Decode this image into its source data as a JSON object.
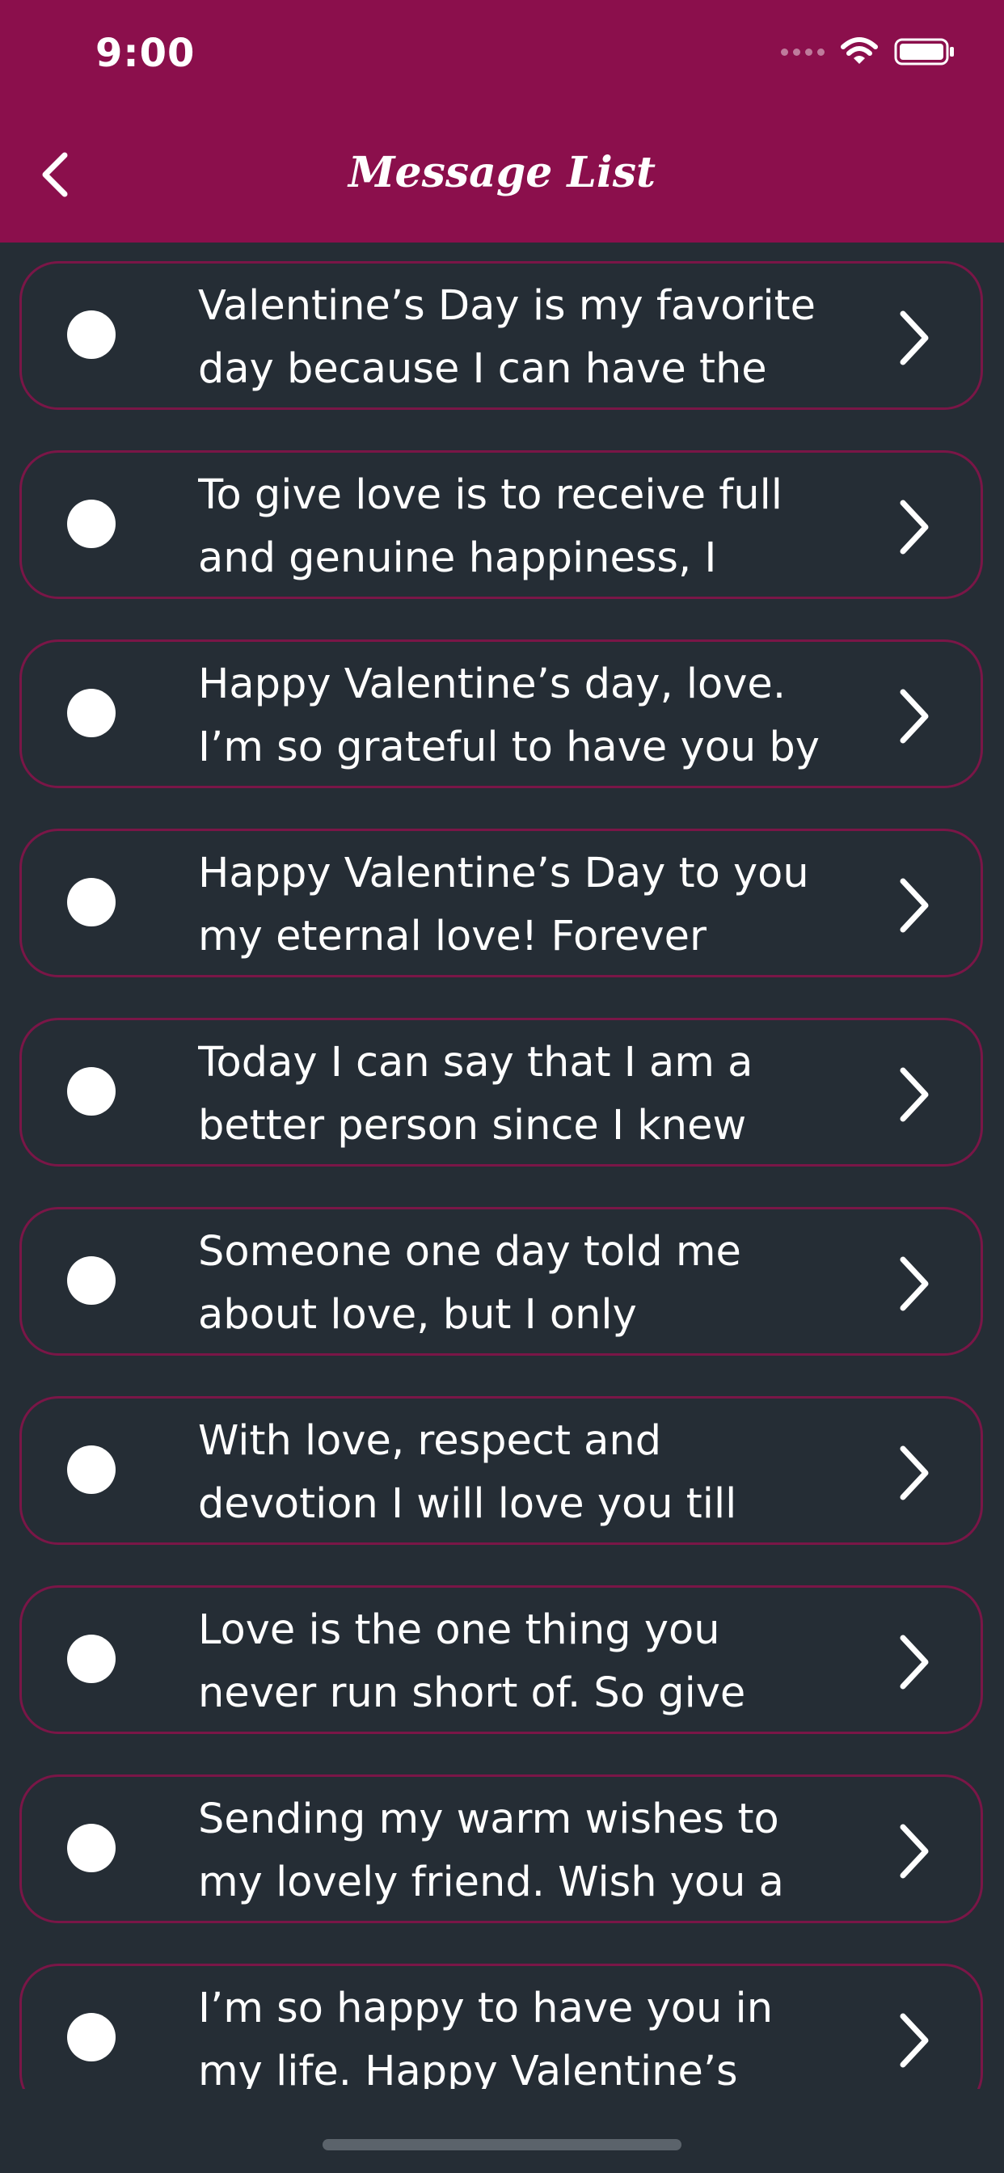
{
  "status_bar": {
    "time": "9:00",
    "signal_icon": "cellular-signal-icon",
    "wifi_icon": "wifi-icon",
    "battery_icon": "battery-icon"
  },
  "header": {
    "title": "Message List",
    "back_icon": "chevron-left-icon"
  },
  "colors": {
    "header_bg": "#8b0f4c",
    "page_bg": "#252d35",
    "item_border": "#7a1647",
    "text": "#ffffff"
  },
  "messages": [
    {
      "line1": "Valentine’s Day is my favorite",
      "line2": "day because I can have the"
    },
    {
      "line1": "To give love is to receive full",
      "line2": "and genuine happiness, I"
    },
    {
      "line1": "Happy Valentine’s day, love.",
      "line2": "I’m so grateful to have you by"
    },
    {
      "line1": "Happy Valentine’s Day to you",
      "line2": "my eternal love! Forever"
    },
    {
      "line1": "Today I can say that I am a",
      "line2": "better person since I knew"
    },
    {
      "line1": "Someone one day told me",
      "line2": "about love, but I only"
    },
    {
      "line1": "With love, respect and",
      "line2": "devotion I will love you till"
    },
    {
      "line1": "Love is the one thing you",
      "line2": "never run short of. So give"
    },
    {
      "line1": "Sending my warm wishes to",
      "line2": "my lovely friend. Wish you a"
    },
    {
      "line1": "I’m so happy to have you in",
      "line2": "my life. Happy Valentine’s"
    }
  ],
  "item_icons": {
    "bullet": "bullet-dot-icon",
    "arrow": "chevron-right-icon"
  }
}
